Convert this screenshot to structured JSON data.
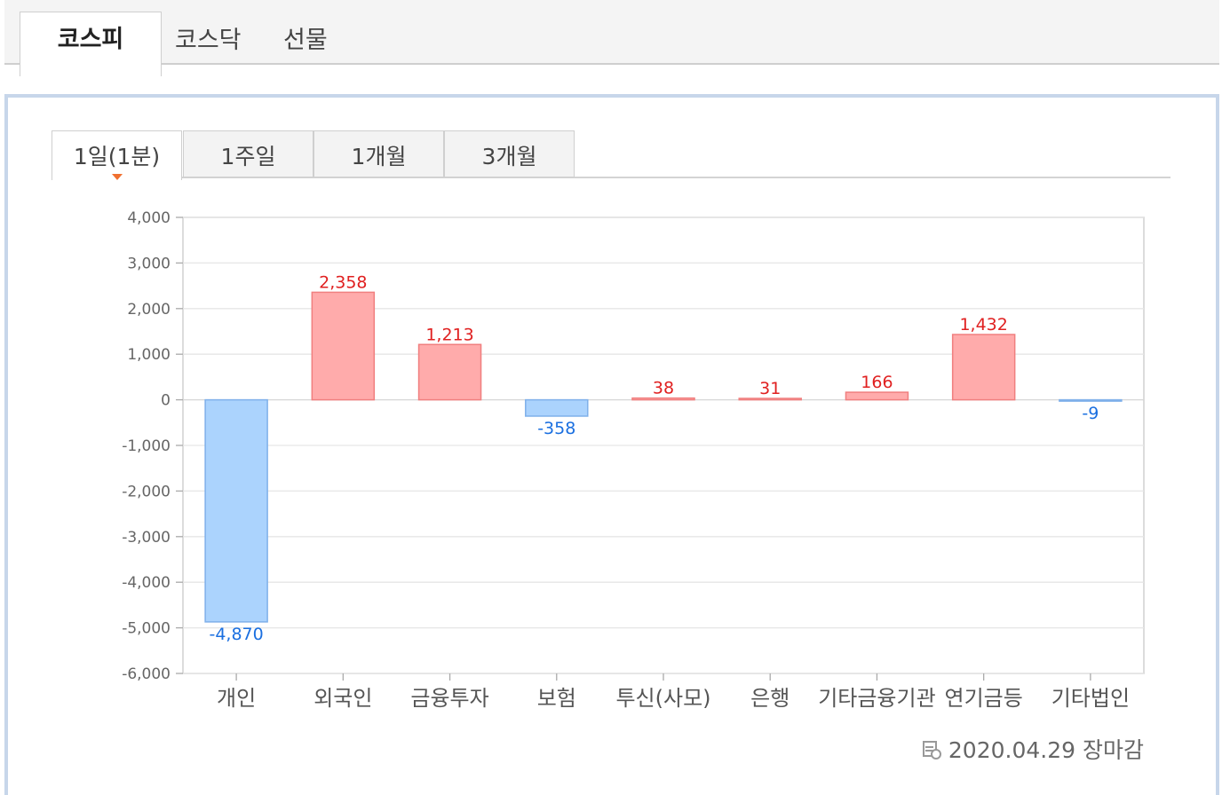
{
  "market_tabs": [
    {
      "label": "코스피",
      "active": true
    },
    {
      "label": "코스닥",
      "active": false
    },
    {
      "label": "선물",
      "active": false
    }
  ],
  "period_tabs": [
    {
      "label": "1일(1분)",
      "active": true
    },
    {
      "label": "1주일",
      "active": false
    },
    {
      "label": "1개월",
      "active": false
    },
    {
      "label": "3개월",
      "active": false
    }
  ],
  "footer": {
    "date": "2020.04.29 장마감",
    "icon": "calendar-clock-icon"
  },
  "colors": {
    "positive_fill": "#ffabab",
    "positive_stroke": "#f07f7f",
    "positive_text": "#e02020",
    "negative_fill": "#abd3fd",
    "negative_stroke": "#7fb0ea",
    "negative_text": "#1a6fe0",
    "grid": "#e6e6e6"
  },
  "chart_data": {
    "type": "bar",
    "categories": [
      "개인",
      "외국인",
      "금융투자",
      "보험",
      "투신(사모)",
      "은행",
      "기타금융기관",
      "연기금등",
      "기타법인"
    ],
    "values": [
      -4870,
      2358,
      1213,
      -358,
      38,
      31,
      166,
      1432,
      -9
    ],
    "data_labels": [
      "-4,870",
      "2,358",
      "1,213",
      "-358",
      "38",
      "31",
      "166",
      "1,432",
      "-9"
    ],
    "yticks": [
      "4,000",
      "3,000",
      "2,000",
      "1,000",
      "0",
      "-1,000",
      "-2,000",
      "-3,000",
      "-4,000",
      "-5,000",
      "-6,000"
    ],
    "ylim": [
      -6000,
      4000
    ],
    "grid": true
  }
}
